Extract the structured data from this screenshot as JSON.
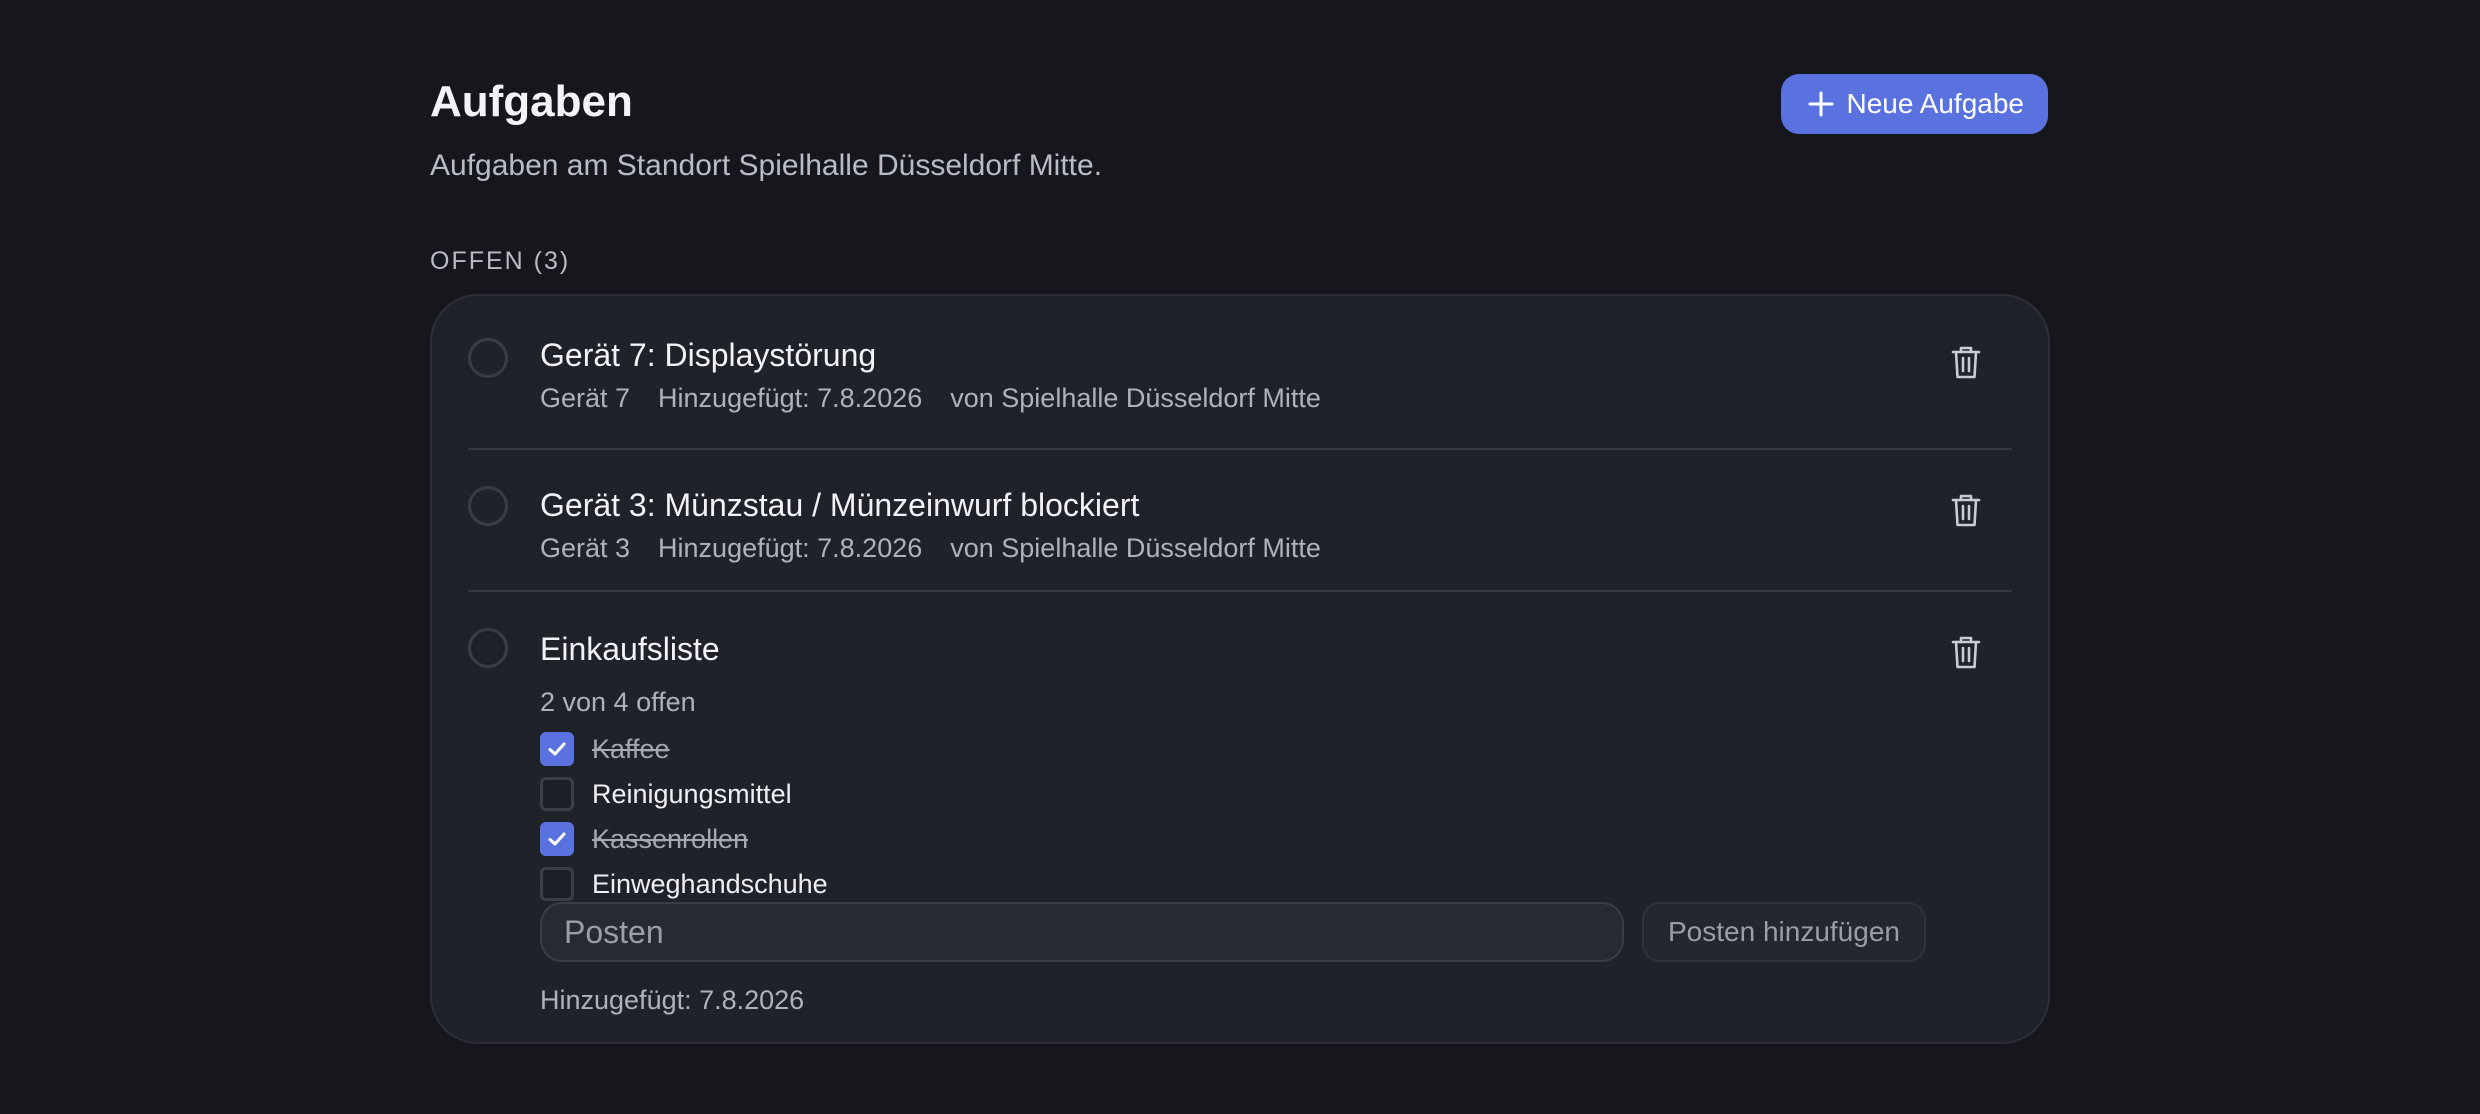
{
  "header": {
    "title": "Aufgaben",
    "subtitle": "Aufgaben am Standort Spielhalle Düsseldorf Mitte.",
    "new_button_label": "Neue Aufgabe",
    "new_button_icon": "plus-icon"
  },
  "section": {
    "label": "OFFEN (3)"
  },
  "tasks": [
    {
      "title": "Gerät 7: Displaystörung",
      "device": "Gerät 7",
      "added": "Hinzugefügt: 7.8.2026",
      "from": "von Spielhalle Düsseldorf Mitte"
    },
    {
      "title": "Gerät 3: Münzstau / Münzeinwurf blockiert",
      "device": "Gerät 3",
      "added": "Hinzugefügt: 7.8.2026",
      "from": "von Spielhalle Düsseldorf Mitte"
    },
    {
      "title": "Einkaufsliste",
      "progress": "2 von 4 offen",
      "items": [
        {
          "label": "Kaffee",
          "checked": true
        },
        {
          "label": "Reinigungsmittel",
          "checked": false
        },
        {
          "label": "Kassenrollen",
          "checked": true
        },
        {
          "label": "Einweghandschuhe",
          "checked": false
        }
      ],
      "input_placeholder": "Posten",
      "input_value": "",
      "add_button_label": "Posten hinzufügen",
      "added": "Hinzugefügt: 7.8.2026"
    }
  ],
  "colors": {
    "background": "#16171c",
    "card": "#20222a",
    "accent": "#5a72e0"
  },
  "icons": {
    "delete": "trash-icon",
    "checkmark": "check-icon"
  }
}
